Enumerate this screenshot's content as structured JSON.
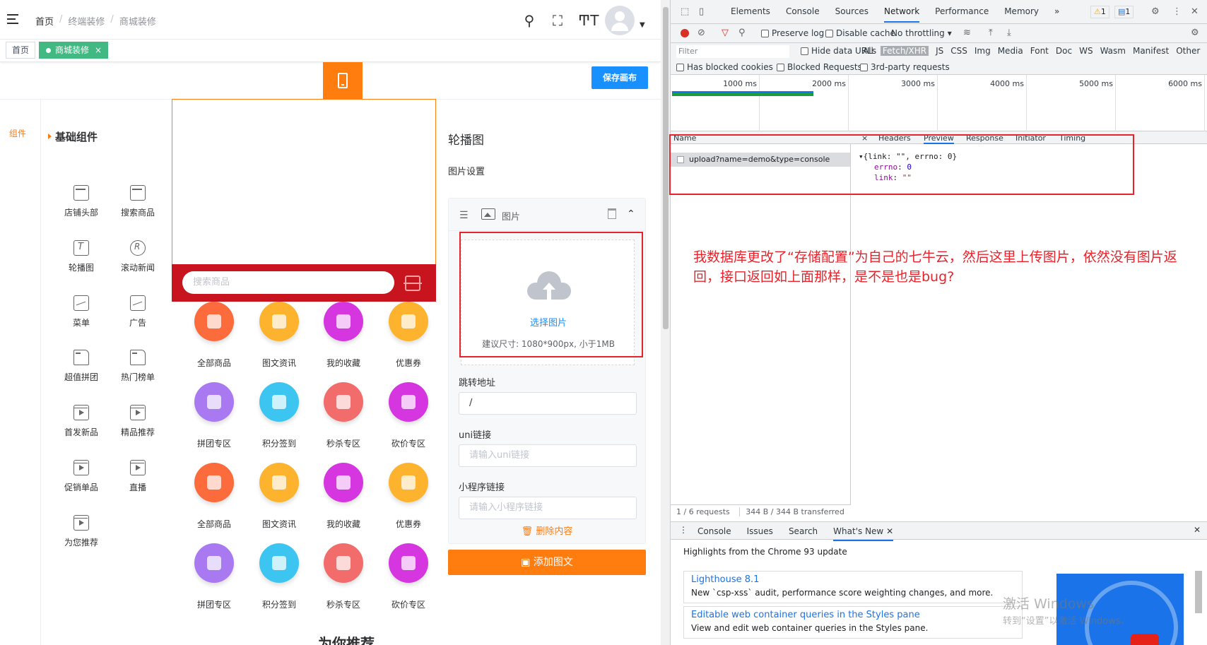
{
  "header": {
    "breadcrumb": [
      "首页",
      "终端装修",
      "商城装修"
    ],
    "breadcrumb_sep": "/"
  },
  "tags": {
    "home": "首页",
    "active": "商城装修",
    "close": "×"
  },
  "toolbar": {
    "save_label": "保存画布"
  },
  "sidebar": {
    "tab": "组件",
    "group": "基础组件",
    "components": [
      {
        "label": "店铺头部",
        "icon": "store-icon"
      },
      {
        "label": "搜索商品",
        "icon": "store-icon"
      },
      {
        "label": "轮播图",
        "icon": "text-icon"
      },
      {
        "label": "滚动新闻",
        "icon": "registered-icon"
      },
      {
        "label": "菜单",
        "icon": "image-icon"
      },
      {
        "label": "广告",
        "icon": "image-icon"
      },
      {
        "label": "超值拼团",
        "icon": "document-icon"
      },
      {
        "label": "热门榜单",
        "icon": "document-icon"
      },
      {
        "label": "首发新品",
        "icon": "video-icon"
      },
      {
        "label": "精品推荐",
        "icon": "video-icon"
      },
      {
        "label": "促销单品",
        "icon": "video-icon"
      },
      {
        "label": "直播",
        "icon": "video-icon"
      },
      {
        "label": "为您推荐",
        "icon": "video-icon"
      }
    ]
  },
  "phone": {
    "search_placeholder": "搜索商品",
    "nav_items": [
      {
        "label": "全部商品",
        "color": "#fb6b3c"
      },
      {
        "label": "图文资讯",
        "color": "#fdb32e"
      },
      {
        "label": "我的收藏",
        "color": "#d536e0"
      },
      {
        "label": "优惠券",
        "color": "#fdb32e"
      },
      {
        "label": "拼团专区",
        "color": "#a979f2"
      },
      {
        "label": "积分签到",
        "color": "#3dc5f1"
      },
      {
        "label": "秒杀专区",
        "color": "#f36c6c"
      },
      {
        "label": "砍价专区",
        "color": "#d536e0"
      },
      {
        "label": "全部商品",
        "color": "#fb6b3c"
      },
      {
        "label": "图文资讯",
        "color": "#fdb32e"
      },
      {
        "label": "我的收藏",
        "color": "#d536e0"
      },
      {
        "label": "优惠券",
        "color": "#fdb32e"
      },
      {
        "label": "拼团专区",
        "color": "#a979f2"
      },
      {
        "label": "积分签到",
        "color": "#3dc5f1"
      },
      {
        "label": "秒杀专区",
        "color": "#f36c6c"
      },
      {
        "label": "砍价专区",
        "color": "#d536e0"
      }
    ],
    "recommend_title": "为你推荐"
  },
  "config": {
    "title": "轮播图",
    "subtitle": "图片设置",
    "card_title": "图片",
    "upload_link": "选择图片",
    "upload_tip": "建议尺寸: 1080*900px, 小于1MB",
    "jump_label": "跳转地址",
    "jump_value": "/",
    "uni_label": "uni链接",
    "uni_placeholder": "请输入uni链接",
    "mini_label": "小程序链接",
    "mini_placeholder": "请输入小程序链接",
    "delete_label": "删除内容",
    "add_label": "添加图文"
  },
  "devtools": {
    "tabs": [
      "Elements",
      "Console",
      "Sources",
      "Network",
      "Performance",
      "Memory",
      "»"
    ],
    "active_tab": "Network",
    "warnings": "1",
    "messages": "1",
    "preserve_log": "Preserve log",
    "disable_cache": "Disable cache",
    "throttling": "No throttling",
    "filter_placeholder": "Filter",
    "hide_data_urls": "Hide data URLs",
    "types": [
      "All",
      "Fetch/XHR",
      "JS",
      "CSS",
      "Img",
      "Media",
      "Font",
      "Doc",
      "WS",
      "Wasm",
      "Manifest",
      "Other"
    ],
    "active_type": "Fetch/XHR",
    "has_blocked_cookies": "Has blocked cookies",
    "blocked_requests": "Blocked Requests",
    "third_party": "3rd-party requests",
    "timeline_ticks": [
      "1000 ms",
      "2000 ms",
      "3000 ms",
      "4000 ms",
      "5000 ms",
      "6000 ms"
    ],
    "columns": {
      "name": "Name",
      "close": "×",
      "headers": "Headers",
      "preview": "Preview",
      "response": "Response",
      "initiator": "Initiator",
      "timing": "Timing"
    },
    "request_name": "upload?name=demo&type=console",
    "preview": {
      "summary": "{link: \"\", errno: 0}",
      "errno_key": "errno",
      "errno_val": "0",
      "link_key": "link",
      "link_val": "\"\""
    },
    "status_requests": "1 / 6 requests",
    "status_transferred": "344 B / 344 B transferred",
    "drawer_tabs": [
      "Console",
      "Issues",
      "Search",
      "What's New"
    ],
    "drawer_active": "What's New",
    "highlights": "Highlights from the Chrome 93 update",
    "whatsnew": [
      {
        "title": "Lighthouse 8.1",
        "desc": "New `csp-xss` audit, performance score weighting changes, and more."
      },
      {
        "title": "Editable web container queries in the Styles pane",
        "desc": "View and edit web container queries in the Styles pane."
      }
    ]
  },
  "annotation": "我数据库更改了“存储配置”为自己的七牛云，然后这里上传图片，依然没有图片返回，接口返回如上面那样，是不是也是bug?",
  "watermark": {
    "line1": "激活 Windows",
    "line2": "转到“设置”以激活 Windows。"
  }
}
